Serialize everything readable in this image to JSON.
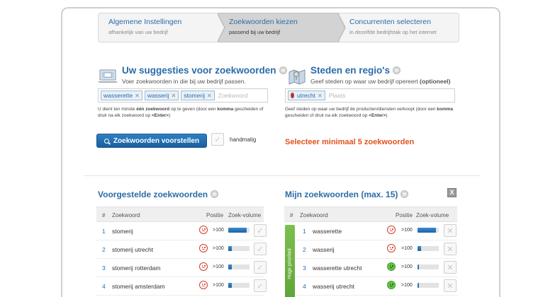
{
  "steps": [
    {
      "title": "Algemene Instellingen",
      "sub": "afhankelijk van uw bedrijf"
    },
    {
      "title": "Zoekwoorden kiezen",
      "sub": "passend bij uw bedrijf"
    },
    {
      "title": "Concurrenten selecteren",
      "sub": "in dezelfde bedrijfstak op het internet"
    }
  ],
  "keywords_section": {
    "title": "Uw suggesties voor zoekwoorden",
    "subtitle": "Voer zoekwoorden in die bij uw bedrijf passen.",
    "tags": [
      "wasserette",
      "wasserij",
      "stomerij"
    ],
    "placeholder": "Zoekwoord",
    "hint_a": "U dient ten minste ",
    "hint_b": "één zoekwoord",
    "hint_c": " op te geven (door een ",
    "hint_d": "komma",
    "hint_e": " gescheiden of druk na elk zoekwoord op ",
    "hint_f": "<Enter>",
    "hint_g": ")",
    "suggest_button": "Zoekwoorden voorstellen",
    "manual_label": "handmatig"
  },
  "regions_section": {
    "title": "Steden en regio's",
    "subtitle_a": "Geef steden op waar uw bedrijf opereert ",
    "subtitle_b": "(optioneel)",
    "tags": [
      "utrecht"
    ],
    "placeholder": "Plaats",
    "hint_a": "Geef steden op waar uw bedrijf de producten/diensten verkoopt (door een ",
    "hint_b": "komma",
    "hint_c": " gescheiden of druk na elk zoekwoord op ",
    "hint_d": "<Enter>",
    "hint_e": ")",
    "warning": "Selecteer minimaal 5 zoekwoorden"
  },
  "suggested": {
    "title": "Voorgestelde zoekwoorden",
    "headers": {
      "num": "#",
      "kw": "Zoekwoord",
      "pos": "Positie",
      "vol": "Zoek-volume"
    },
    "rows": [
      {
        "num": "1",
        "kw": "stomerij",
        "pos": ">100",
        "vol": 0.85,
        "face": "bad"
      },
      {
        "num": "2",
        "kw": "stomerij utrecht",
        "pos": ">100",
        "vol": 0.15,
        "face": "bad"
      },
      {
        "num": "3",
        "kw": "stomerij rotterdam",
        "pos": ">100",
        "vol": 0.15,
        "face": "bad"
      },
      {
        "num": "4",
        "kw": "stomerij amsterdam",
        "pos": ">100",
        "vol": 0.15,
        "face": "bad"
      }
    ]
  },
  "mine": {
    "title": "Mijn zoekwoorden (max. 15)",
    "headers": {
      "num": "#",
      "kw": "Zoekwoord",
      "pos": "Positie",
      "vol": "Zoek-volume"
    },
    "priority_label": "Hoge prioriteit",
    "rows": [
      {
        "num": "1",
        "kw": "wasserette",
        "pos": ">100",
        "vol": 0.85,
        "face": "bad"
      },
      {
        "num": "2",
        "kw": "wasserij",
        "pos": ">100",
        "vol": 0.15,
        "face": "bad"
      },
      {
        "num": "3",
        "kw": "wasserette utrecht",
        "pos": ">100",
        "vol": 0.08,
        "face": "good"
      },
      {
        "num": "4",
        "kw": "wasserij utrecht",
        "pos": ">100",
        "vol": 0.08,
        "face": "good"
      }
    ]
  }
}
